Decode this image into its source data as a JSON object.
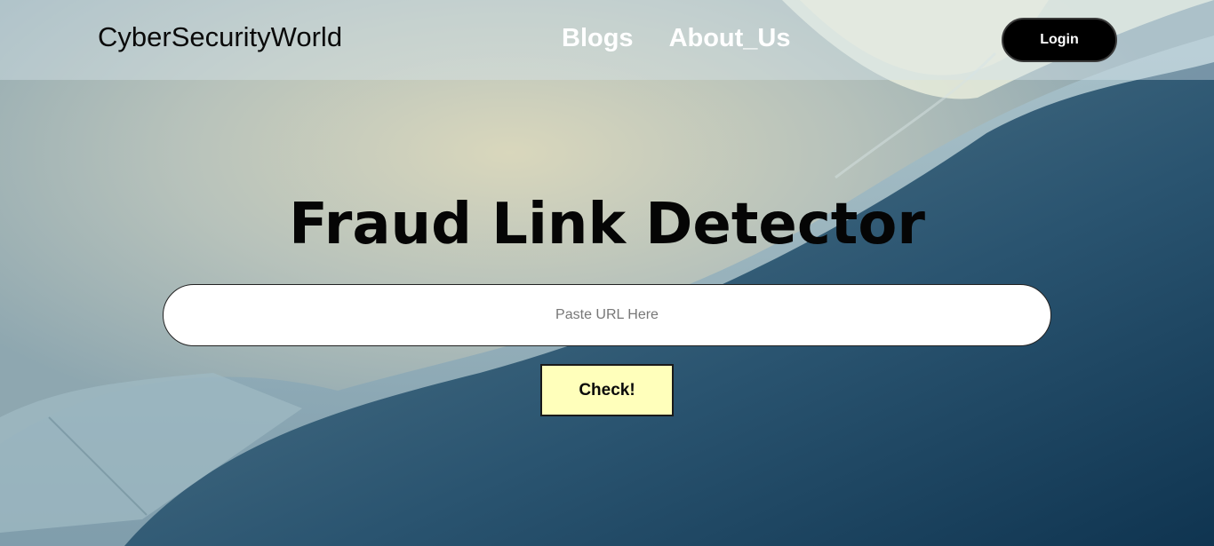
{
  "navbar": {
    "brand": "CyberSecurityWorld",
    "links": [
      {
        "label": "Blogs"
      },
      {
        "label": "About_Us"
      }
    ],
    "login_label": "Login"
  },
  "hero": {
    "title": "Fraud Link Detector",
    "url_input": {
      "placeholder": "Paste URL Here",
      "value": ""
    },
    "check_label": "Check!"
  },
  "colors": {
    "navbar_overlay": "#d6e4ec",
    "login_bg": "#000000",
    "check_bg": "#ffffbb",
    "title": "#050505",
    "nav_link": "#ffffff"
  }
}
